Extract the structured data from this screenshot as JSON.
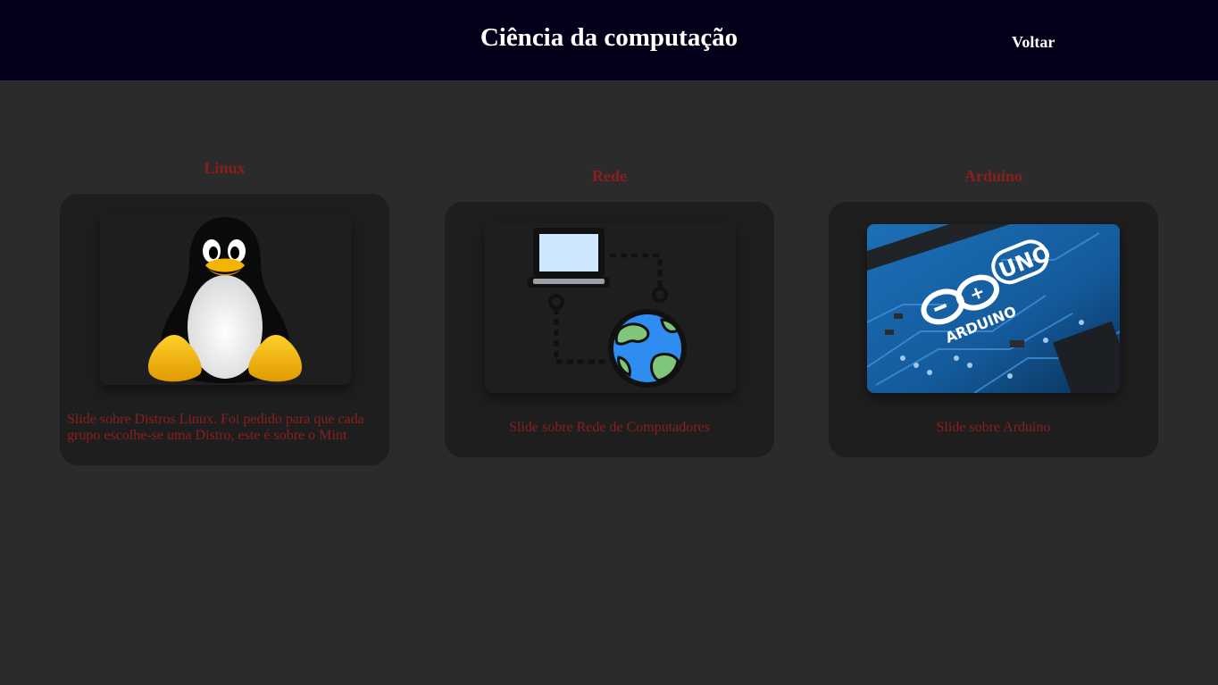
{
  "header": {
    "title": "Ciência da computação",
    "back_label": "Voltar"
  },
  "cards": [
    {
      "title": "Linux",
      "image_icon": "tux-penguin-icon",
      "description": " Slide sobre Distros Linux. Foi pedido para que cada grupo escolhe-se uma Distro, este é sobre o Mint"
    },
    {
      "title": "Rede",
      "image_icon": "computer-network-icon",
      "description": "Slide sobre Rede de Computadores"
    },
    {
      "title": "Arduino",
      "image_icon": "arduino-board-icon",
      "image_text": [
        "UNO",
        "ARDUINO"
      ],
      "description": "Slide sobre Arduino"
    }
  ],
  "colors": {
    "header_bg": "#03001a",
    "page_bg": "#2b2b2b",
    "card_bg": "#1e1e1e",
    "accent_text": "#8b1e1e"
  }
}
